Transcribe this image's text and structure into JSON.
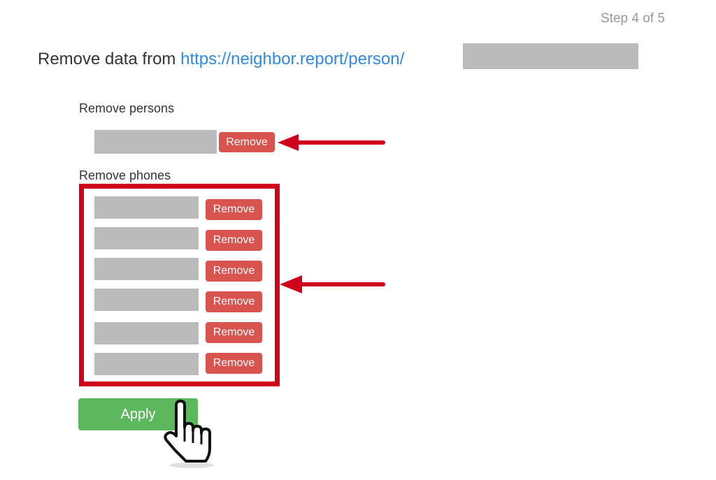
{
  "header": {
    "step_text": "Step 4 of 5",
    "title_prefix": "Remove data from ",
    "title_link": "https://neighbor.report/person/"
  },
  "persons_section": {
    "label": "Remove persons",
    "items": [
      {
        "button_label": "Remove"
      }
    ]
  },
  "phones_section": {
    "label": "Remove phones",
    "items": [
      {
        "button_label": "Remove"
      },
      {
        "button_label": "Remove"
      },
      {
        "button_label": "Remove"
      },
      {
        "button_label": "Remove"
      },
      {
        "button_label": "Remove"
      },
      {
        "button_label": "Remove"
      }
    ]
  },
  "actions": {
    "apply_label": "Apply"
  },
  "colors": {
    "link": "#2f8ae6",
    "remove_button": "#d9534f",
    "apply_button": "#5cb85c",
    "annotation": "#d0021b",
    "redaction": "#bbbbbb"
  }
}
